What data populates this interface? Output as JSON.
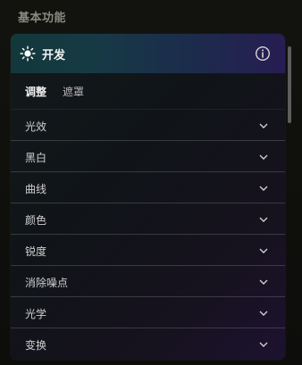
{
  "section": {
    "title": "基本功能"
  },
  "panel": {
    "title": "开发",
    "tabs": [
      {
        "label": "调整",
        "active": true
      },
      {
        "label": "遮罩",
        "active": false
      }
    ],
    "items": [
      {
        "label": "光效"
      },
      {
        "label": "黑白"
      },
      {
        "label": "曲线"
      },
      {
        "label": "颜色"
      },
      {
        "label": "锐度"
      },
      {
        "label": "消除噪点"
      },
      {
        "label": "光学"
      },
      {
        "label": "变换"
      }
    ]
  },
  "icons": {
    "panel_icon": "sun-icon",
    "info": "info-icon",
    "expand": "chevron-down-icon"
  },
  "colors": {
    "header_gradient_start": "#12383a",
    "header_gradient_end": "#271d52",
    "divider": "#3a3a3f"
  }
}
